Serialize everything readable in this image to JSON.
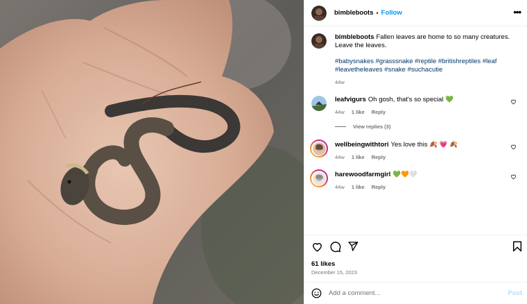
{
  "post": {
    "username": "bimbleboots",
    "separator": "•",
    "follow_label": "Follow",
    "more_icon": "more-options-icon"
  },
  "caption": {
    "username": "bimbleboots",
    "text": "Fallen leaves are home to so many creatures. Leave the leaves.",
    "hashtags": "#babysnakes #grasssnake #reptile #britishreptiles #leaf #leavetheleaves #snake #suchacutie",
    "age": "44w"
  },
  "comments": [
    {
      "username": "leafvigurs",
      "text": "Oh gosh, that's so special 💚",
      "age": "44w",
      "likes": "1 like",
      "reply": "Reply"
    },
    {
      "username": "wellbeingwithtori",
      "text": "Yes love this 🍂 💗 🍂",
      "age": "44w",
      "likes": "1 like",
      "reply": "Reply"
    },
    {
      "username": "harewoodfarmgirl",
      "text": "💚🧡🤍",
      "age": "44w",
      "likes": "1 like",
      "reply": "Reply"
    }
  ],
  "view_replies": "View replies (3)",
  "engagement": {
    "likes": "61 likes",
    "date": "December 15, 2023"
  },
  "add_comment": {
    "placeholder": "Add a comment...",
    "post_label": "Post"
  },
  "colors": {
    "accent": "#0095f6",
    "hashtag": "#00376b",
    "muted": "#737373",
    "post_disabled": "#b2dffc"
  }
}
